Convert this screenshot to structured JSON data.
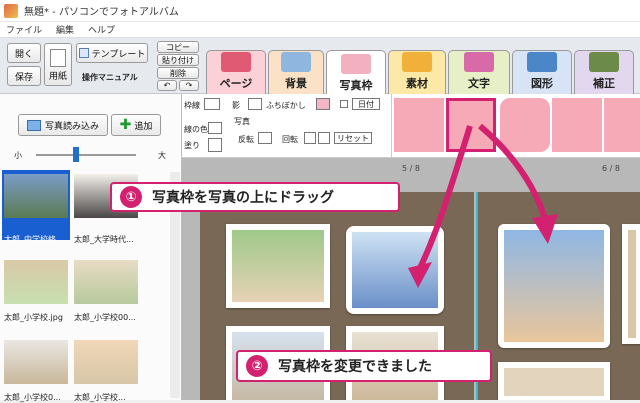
{
  "title": "無題* - パソコンでフォトアルバム",
  "menu": [
    "ファイル",
    "編集",
    "ヘルプ"
  ],
  "toolbar": {
    "open": "開く",
    "save": "保存",
    "paper": "用紙",
    "template": "テンプレート",
    "manual": "操作マニュアル",
    "copy": "コピー",
    "paste": "貼り付け",
    "delete": "削除"
  },
  "tabs": [
    "ページ",
    "背景",
    "写真枠",
    "素材",
    "文字",
    "図形",
    "補正"
  ],
  "left": {
    "load_photo": "写真読み込み",
    "add": "追加",
    "small": "小",
    "large": "大",
    "slider_value": 0.4,
    "thumbs": [
      {
        "label": "太郎_中学校終..."
      },
      {
        "label": "太郎_大学時代..."
      },
      {
        "label": "太郎_小学校.jpg"
      },
      {
        "label": "太郎_小学校00..."
      },
      {
        "label": "太郎_小学校0..."
      },
      {
        "label": "太郎_小学校..."
      }
    ]
  },
  "props": {
    "frame_line": "枠線",
    "shadow": "影",
    "blur": "ふちぼかし",
    "date": "日付",
    "line_color": "線の色",
    "fill": "塗り",
    "photo": "写真",
    "flip": "反転",
    "rotate": "回転",
    "reset": "リセット"
  },
  "canvas": {
    "page_label_left": "5 / 8",
    "page_label_right": "6 / 8"
  },
  "callouts": {
    "step1_num": "①",
    "step1_text": "写真枠を写真の上にドラッグ",
    "step2_num": "②",
    "step2_text": "写真枠を変更できました"
  },
  "colors": {
    "accent": "#d4216f",
    "frame_pink": "#f6a9b6",
    "page_bg": "#7a6856"
  }
}
